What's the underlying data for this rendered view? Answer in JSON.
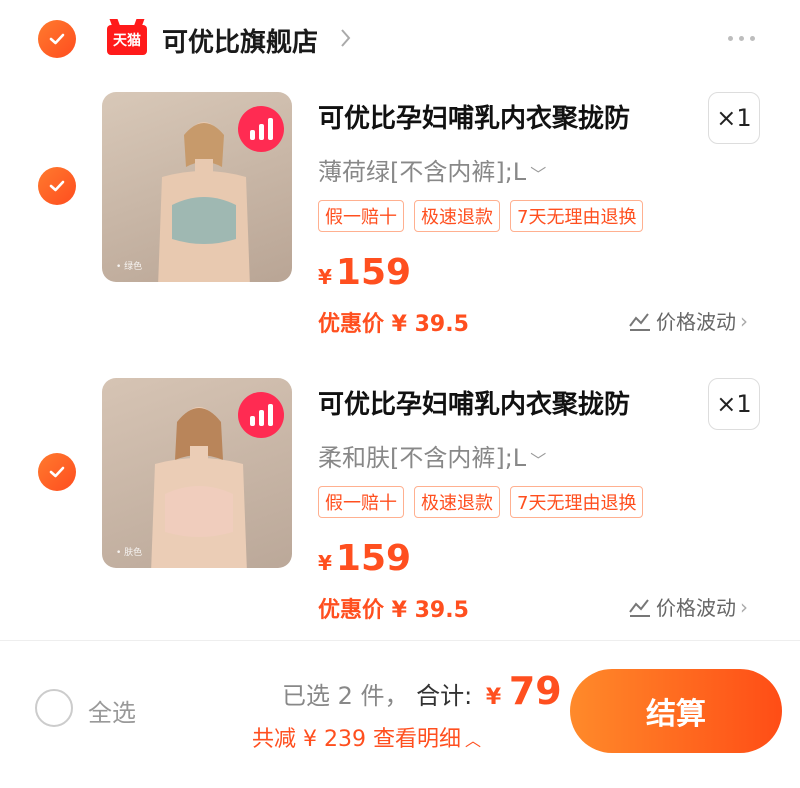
{
  "store": {
    "logo_text": "天猫",
    "name": "可优比旗舰店"
  },
  "items": [
    {
      "title": "可优比孕妇哺乳内衣聚拢防",
      "quantity": "×1",
      "variant": "薄荷绿[不含内裤];L",
      "tags": [
        "假一赔十",
        "极速退款",
        "7天无理由退换"
      ],
      "price_symbol": "¥",
      "price": "159",
      "promo": "优惠价 ¥ 39.5",
      "trend_label": "价格波动",
      "thumb_caption": "• 绿色",
      "thumb_color": "#c9b8a8"
    },
    {
      "title": "可优比孕妇哺乳内衣聚拢防",
      "quantity": "×1",
      "variant": "柔和肤[不含内裤];L",
      "tags": [
        "假一赔十",
        "极速退款",
        "7天无理由退换"
      ],
      "price_symbol": "¥",
      "price": "159",
      "promo": "优惠价 ¥ 39.5",
      "trend_label": "价格波动",
      "thumb_caption": "• 肤色",
      "thumb_color": "#cdb9aa"
    }
  ],
  "footer": {
    "select_all": "全选",
    "selected_count": "已选 2 件，",
    "total_label": "合计:",
    "total_symbol": "¥",
    "total_value": "79",
    "discount_text": "共减 ¥ 239  查看明细",
    "checkout_label": "结算"
  },
  "colors": {
    "accent": "#ff4f1f",
    "check": "#ff6a24",
    "tmall_red": "#ff1a1a"
  }
}
